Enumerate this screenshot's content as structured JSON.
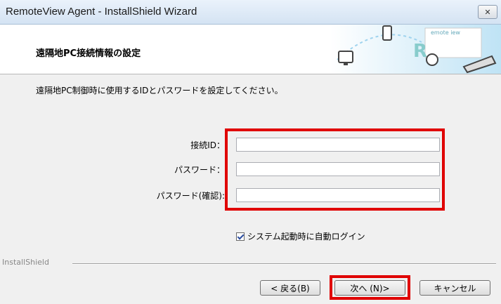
{
  "window": {
    "title": "RemoteView Agent - InstallShield Wizard",
    "close_symbol": "✕"
  },
  "banner": {
    "title": "遠隔地PC接続情報の設定",
    "art_text": "emote iew"
  },
  "content": {
    "instruction": "遠隔地PC制御時に使用するIDとパスワードを設定してください。",
    "fields": [
      {
        "label": "接続ID：",
        "value": ""
      },
      {
        "label": "パスワード：",
        "value": ""
      },
      {
        "label": "パスワード(確認):",
        "value": ""
      }
    ],
    "autologin": {
      "label": "システム起動時に自動ログイン",
      "checked": true
    }
  },
  "footer": {
    "brand": "InstallShield",
    "buttons": {
      "back": "< 戻る(B)",
      "next": "次へ (N)>",
      "cancel": "キャンセル"
    }
  },
  "colors": {
    "highlight": "#e00000",
    "titlebar": "#d4e3f3"
  }
}
